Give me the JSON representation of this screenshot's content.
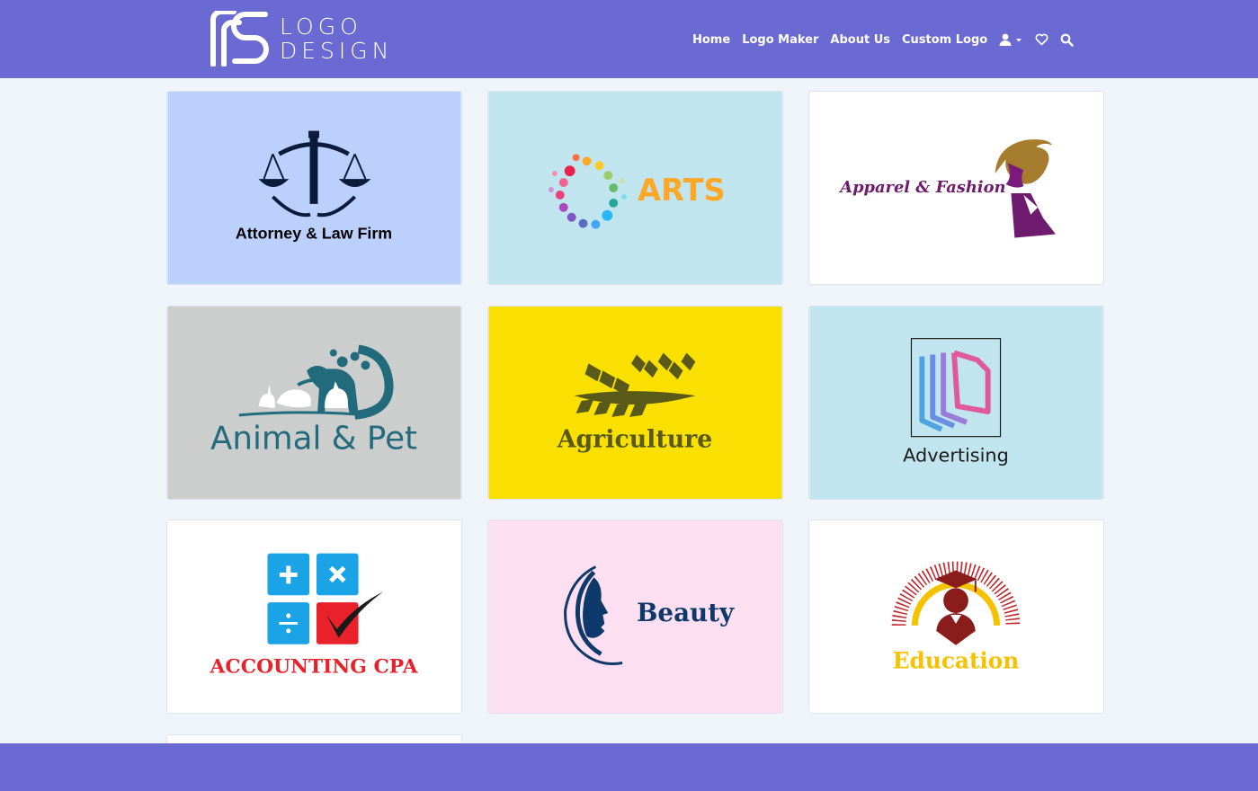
{
  "header": {
    "brand_line1": "LOGO",
    "brand_line2": "DESIGN",
    "background": "#6a6ad2",
    "nav": [
      "Home",
      "Logo Maker",
      "About Us",
      "Custom Logo"
    ],
    "icons": [
      "user-icon",
      "caret-down-icon",
      "heart-icon",
      "search-icon"
    ]
  },
  "cards": [
    {
      "label": "Attorney & Law Firm",
      "bg": "#bcd0fd"
    },
    {
      "label": "ARTS",
      "bg": "#c1e5ee"
    },
    {
      "label": "Apparel & Fashion",
      "bg": "#ffffff"
    },
    {
      "label": "Animal & Pet",
      "bg": "#cccdcd"
    },
    {
      "label": "Agriculture",
      "bg": "#fae000"
    },
    {
      "label": "Advertising",
      "bg": "#c1e5ee"
    },
    {
      "label": "ACCOUNTING CPA",
      "bg": "#ffffff"
    },
    {
      "label": "Beauty",
      "bg": "#fcdff0"
    },
    {
      "label": "Education",
      "bg": "#ffffff"
    }
  ],
  "footer": {
    "background": "#6a6ad2"
  }
}
